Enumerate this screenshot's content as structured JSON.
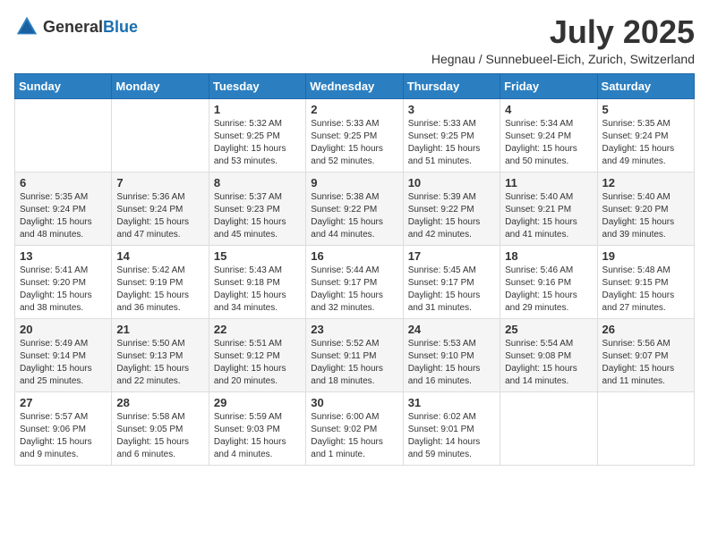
{
  "header": {
    "logo_general": "General",
    "logo_blue": "Blue",
    "month_title": "July 2025",
    "location": "Hegnau / Sunnebueel-Eich, Zurich, Switzerland"
  },
  "days_of_week": [
    "Sunday",
    "Monday",
    "Tuesday",
    "Wednesday",
    "Thursday",
    "Friday",
    "Saturday"
  ],
  "weeks": [
    [
      {
        "day": "",
        "info": ""
      },
      {
        "day": "",
        "info": ""
      },
      {
        "day": "1",
        "info": "Sunrise: 5:32 AM\nSunset: 9:25 PM\nDaylight: 15 hours\nand 53 minutes."
      },
      {
        "day": "2",
        "info": "Sunrise: 5:33 AM\nSunset: 9:25 PM\nDaylight: 15 hours\nand 52 minutes."
      },
      {
        "day": "3",
        "info": "Sunrise: 5:33 AM\nSunset: 9:25 PM\nDaylight: 15 hours\nand 51 minutes."
      },
      {
        "day": "4",
        "info": "Sunrise: 5:34 AM\nSunset: 9:24 PM\nDaylight: 15 hours\nand 50 minutes."
      },
      {
        "day": "5",
        "info": "Sunrise: 5:35 AM\nSunset: 9:24 PM\nDaylight: 15 hours\nand 49 minutes."
      }
    ],
    [
      {
        "day": "6",
        "info": "Sunrise: 5:35 AM\nSunset: 9:24 PM\nDaylight: 15 hours\nand 48 minutes."
      },
      {
        "day": "7",
        "info": "Sunrise: 5:36 AM\nSunset: 9:24 PM\nDaylight: 15 hours\nand 47 minutes."
      },
      {
        "day": "8",
        "info": "Sunrise: 5:37 AM\nSunset: 9:23 PM\nDaylight: 15 hours\nand 45 minutes."
      },
      {
        "day": "9",
        "info": "Sunrise: 5:38 AM\nSunset: 9:22 PM\nDaylight: 15 hours\nand 44 minutes."
      },
      {
        "day": "10",
        "info": "Sunrise: 5:39 AM\nSunset: 9:22 PM\nDaylight: 15 hours\nand 42 minutes."
      },
      {
        "day": "11",
        "info": "Sunrise: 5:40 AM\nSunset: 9:21 PM\nDaylight: 15 hours\nand 41 minutes."
      },
      {
        "day": "12",
        "info": "Sunrise: 5:40 AM\nSunset: 9:20 PM\nDaylight: 15 hours\nand 39 minutes."
      }
    ],
    [
      {
        "day": "13",
        "info": "Sunrise: 5:41 AM\nSunset: 9:20 PM\nDaylight: 15 hours\nand 38 minutes."
      },
      {
        "day": "14",
        "info": "Sunrise: 5:42 AM\nSunset: 9:19 PM\nDaylight: 15 hours\nand 36 minutes."
      },
      {
        "day": "15",
        "info": "Sunrise: 5:43 AM\nSunset: 9:18 PM\nDaylight: 15 hours\nand 34 minutes."
      },
      {
        "day": "16",
        "info": "Sunrise: 5:44 AM\nSunset: 9:17 PM\nDaylight: 15 hours\nand 32 minutes."
      },
      {
        "day": "17",
        "info": "Sunrise: 5:45 AM\nSunset: 9:17 PM\nDaylight: 15 hours\nand 31 minutes."
      },
      {
        "day": "18",
        "info": "Sunrise: 5:46 AM\nSunset: 9:16 PM\nDaylight: 15 hours\nand 29 minutes."
      },
      {
        "day": "19",
        "info": "Sunrise: 5:48 AM\nSunset: 9:15 PM\nDaylight: 15 hours\nand 27 minutes."
      }
    ],
    [
      {
        "day": "20",
        "info": "Sunrise: 5:49 AM\nSunset: 9:14 PM\nDaylight: 15 hours\nand 25 minutes."
      },
      {
        "day": "21",
        "info": "Sunrise: 5:50 AM\nSunset: 9:13 PM\nDaylight: 15 hours\nand 22 minutes."
      },
      {
        "day": "22",
        "info": "Sunrise: 5:51 AM\nSunset: 9:12 PM\nDaylight: 15 hours\nand 20 minutes."
      },
      {
        "day": "23",
        "info": "Sunrise: 5:52 AM\nSunset: 9:11 PM\nDaylight: 15 hours\nand 18 minutes."
      },
      {
        "day": "24",
        "info": "Sunrise: 5:53 AM\nSunset: 9:10 PM\nDaylight: 15 hours\nand 16 minutes."
      },
      {
        "day": "25",
        "info": "Sunrise: 5:54 AM\nSunset: 9:08 PM\nDaylight: 15 hours\nand 14 minutes."
      },
      {
        "day": "26",
        "info": "Sunrise: 5:56 AM\nSunset: 9:07 PM\nDaylight: 15 hours\nand 11 minutes."
      }
    ],
    [
      {
        "day": "27",
        "info": "Sunrise: 5:57 AM\nSunset: 9:06 PM\nDaylight: 15 hours\nand 9 minutes."
      },
      {
        "day": "28",
        "info": "Sunrise: 5:58 AM\nSunset: 9:05 PM\nDaylight: 15 hours\nand 6 minutes."
      },
      {
        "day": "29",
        "info": "Sunrise: 5:59 AM\nSunset: 9:03 PM\nDaylight: 15 hours\nand 4 minutes."
      },
      {
        "day": "30",
        "info": "Sunrise: 6:00 AM\nSunset: 9:02 PM\nDaylight: 15 hours\nand 1 minute."
      },
      {
        "day": "31",
        "info": "Sunrise: 6:02 AM\nSunset: 9:01 PM\nDaylight: 14 hours\nand 59 minutes."
      },
      {
        "day": "",
        "info": ""
      },
      {
        "day": "",
        "info": ""
      }
    ]
  ]
}
